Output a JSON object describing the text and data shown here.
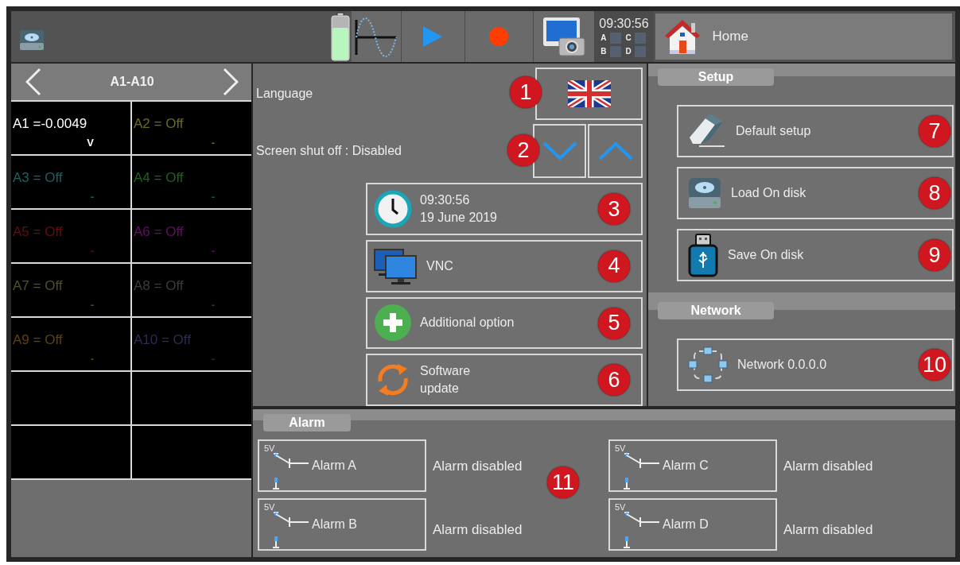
{
  "topbar": {
    "clock": "09:30:56",
    "indicators": [
      "A",
      "C",
      "B",
      "D"
    ],
    "home_button": "Home"
  },
  "channel_panel": {
    "title": "A1-A10",
    "channels": [
      {
        "reading": "A1 =-0.0049",
        "unit": "V",
        "color": "#ffffff"
      },
      {
        "reading": "A2 = Off",
        "unit": "-",
        "color": "#6b6b1e"
      },
      {
        "reading": "A3 = Off",
        "unit": "-",
        "color": "#1e6060"
      },
      {
        "reading": "A4 = Off",
        "unit": "-",
        "color": "#1e601e"
      },
      {
        "reading": "A5 = Off",
        "unit": "-",
        "color": "#600e0e"
      },
      {
        "reading": "A6 = Off",
        "unit": "-",
        "color": "#601060"
      },
      {
        "reading": "A7 = Off",
        "unit": "-",
        "color": "#50502a"
      },
      {
        "reading": "A8 = Off",
        "unit": "-",
        "color": "#3c3c3c"
      },
      {
        "reading": "A9 = Off",
        "unit": "-",
        "color": "#5c4210"
      },
      {
        "reading": "A10 = Off",
        "unit": "-",
        "color": "#2c2c52"
      }
    ]
  },
  "language": {
    "label": "Language",
    "badge": "1"
  },
  "screen_shutoff": {
    "label": "Screen shut off : Disabled",
    "badge": "2"
  },
  "actions": [
    {
      "kind": "clock",
      "lines": [
        "09:30:56",
        "19 June 2019"
      ],
      "badge": "3"
    },
    {
      "kind": "vnc",
      "lines": [
        "VNC"
      ],
      "badge": "4"
    },
    {
      "kind": "add",
      "lines": [
        "Additional option"
      ],
      "badge": "5"
    },
    {
      "kind": "update",
      "lines": [
        "Software",
        "update"
      ],
      "badge": "6"
    }
  ],
  "setup": {
    "title": "Setup",
    "buttons": [
      {
        "kind": "eraser",
        "label": "Default setup",
        "badge": "7"
      },
      {
        "kind": "disk",
        "label": "Load On disk",
        "badge": "8"
      },
      {
        "kind": "usb",
        "label": "Save On disk",
        "badge": "9"
      }
    ]
  },
  "network": {
    "title": "Network",
    "buttons": [
      {
        "kind": "network",
        "label": "Network 0.0.0.0",
        "badge": "10"
      }
    ]
  },
  "alarm": {
    "title": "Alarm",
    "badge": "11",
    "alarms": [
      {
        "supply": "5V",
        "label": "Alarm A",
        "status": "Alarm disabled"
      },
      {
        "supply": "5V",
        "label": "Alarm C",
        "status": "Alarm disabled"
      },
      {
        "supply": "5V",
        "label": "Alarm B",
        "status": "Alarm disabled"
      },
      {
        "supply": "5V",
        "label": "Alarm D",
        "status": "Alarm disabled"
      }
    ]
  }
}
